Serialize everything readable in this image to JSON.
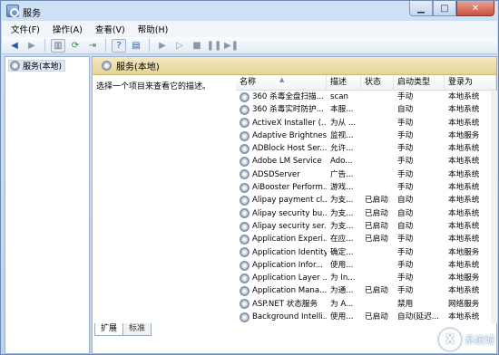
{
  "window": {
    "title": "服务"
  },
  "menu": [
    "文件(F)",
    "操作(A)",
    "查看(V)",
    "帮助(H)"
  ],
  "toolbar": {
    "icons": [
      "back-icon",
      "forward-icon",
      "show-hide-tree-icon",
      "refresh-icon",
      "export-icon",
      "help-icon",
      "properties-icon",
      "start-icon",
      "start-alt-icon",
      "stop-icon",
      "pause-icon",
      "restart-icon"
    ]
  },
  "tree": {
    "item": "服务(本地)"
  },
  "main": {
    "header": "服务(本地)",
    "description_prompt": "选择一个项目来查看它的描述。"
  },
  "table": {
    "columns": [
      "名称",
      "描述",
      "状态",
      "启动类型",
      "登录为"
    ],
    "rows": [
      {
        "name": "360 杀毒全盘扫描...",
        "desc": "scan",
        "status": "",
        "start": "手动",
        "logon": "本地系统"
      },
      {
        "name": "360 杀毒实时防护...",
        "desc": "本服...",
        "status": "",
        "start": "自动",
        "logon": "本地系统"
      },
      {
        "name": "ActiveX Installer (...",
        "desc": "为从 ...",
        "status": "",
        "start": "手动",
        "logon": "本地系统"
      },
      {
        "name": "Adaptive Brightness",
        "desc": "监视...",
        "status": "",
        "start": "手动",
        "logon": "本地服务"
      },
      {
        "name": "ADBlock Host Ser...",
        "desc": "允许...",
        "status": "",
        "start": "手动",
        "logon": "本地系统"
      },
      {
        "name": "Adobe LM Service",
        "desc": "Ado...",
        "status": "",
        "start": "手动",
        "logon": "本地系统"
      },
      {
        "name": "ADSDServer",
        "desc": "广告...",
        "status": "",
        "start": "手动",
        "logon": "本地系统"
      },
      {
        "name": "AiBooster Perform...",
        "desc": "游戏...",
        "status": "",
        "start": "手动",
        "logon": "本地系统"
      },
      {
        "name": "Alipay payment cl...",
        "desc": "为支...",
        "status": "已启动",
        "start": "自动",
        "logon": "本地系统"
      },
      {
        "name": "Alipay security bu...",
        "desc": "为支...",
        "status": "已启动",
        "start": "自动",
        "logon": "本地系统"
      },
      {
        "name": "Alipay security ser...",
        "desc": "为支...",
        "status": "已启动",
        "start": "自动",
        "logon": "本地系统"
      },
      {
        "name": "Application Experi...",
        "desc": "在应...",
        "status": "已启动",
        "start": "手动",
        "logon": "本地系统"
      },
      {
        "name": "Application Identity",
        "desc": "确定...",
        "status": "",
        "start": "手动",
        "logon": "本地服务"
      },
      {
        "name": "Application Infor...",
        "desc": "使用...",
        "status": "",
        "start": "手动",
        "logon": "本地系统"
      },
      {
        "name": "Application Layer ...",
        "desc": "为 In...",
        "status": "",
        "start": "手动",
        "logon": "本地服务"
      },
      {
        "name": "Application Mana...",
        "desc": "为通...",
        "status": "已启动",
        "start": "手动",
        "logon": "本地系统"
      },
      {
        "name": "ASP.NET 状态服务",
        "desc": "为 A...",
        "status": "",
        "start": "禁用",
        "logon": "网络服务"
      },
      {
        "name": "Background Intelli...",
        "desc": "使用...",
        "status": "已启动",
        "start": "自动(延迟...",
        "logon": "本地系统"
      }
    ]
  },
  "tabs": [
    "扩展",
    "标准"
  ],
  "watermark": {
    "text": "系统城",
    "glyph": "X"
  }
}
